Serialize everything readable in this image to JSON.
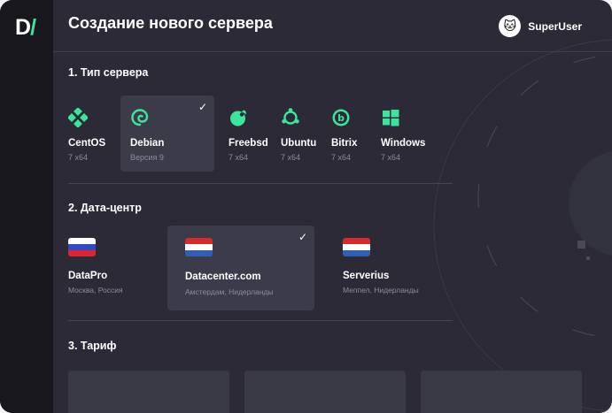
{
  "app": {
    "logo_main": "D",
    "logo_slash": "/"
  },
  "header": {
    "title": "Создание нового сервера",
    "user_name": "SuperUser",
    "avatar_icon": "fox-avatar-icon"
  },
  "sections": {
    "server_type": "1. Тип сервера",
    "datacenter": "2. Дата-центр",
    "tariff": "3. Тариф"
  },
  "os_options": [
    {
      "name": "CentOS",
      "subtitle": "7 x64",
      "icon": "centos-icon",
      "selected": false
    },
    {
      "name": "Debian",
      "subtitle": "Версия 9",
      "icon": "debian-icon",
      "selected": true
    },
    {
      "name": "Freebsd",
      "subtitle": "7 x64",
      "icon": "freebsd-icon",
      "selected": false
    },
    {
      "name": "Ubuntu",
      "subtitle": "7 x64",
      "icon": "ubuntu-icon",
      "selected": false
    },
    {
      "name": "Bitrix",
      "subtitle": "7 x64",
      "icon": "bitrix-icon",
      "selected": false
    },
    {
      "name": "Windows",
      "subtitle": "7 x64",
      "icon": "windows-icon",
      "selected": false
    }
  ],
  "datacenters": [
    {
      "name": "DataPro",
      "location": "Москва, Россия",
      "flag": "russia-flag",
      "selected": false
    },
    {
      "name": "Datacenter.com",
      "location": "Амстердам, Нидерланды",
      "flag": "netherlands-flag",
      "selected": true
    },
    {
      "name": "Serverius",
      "location": "Меппел, Нидерланды",
      "flag": "netherlands-flag",
      "selected": false
    }
  ],
  "check_mark": "✓",
  "colors": {
    "accent": "#3ce59b",
    "background": "#2b2a36",
    "rail": "#18171d",
    "card_selected": "#3c3b49",
    "muted_text": "#8d8c99"
  }
}
